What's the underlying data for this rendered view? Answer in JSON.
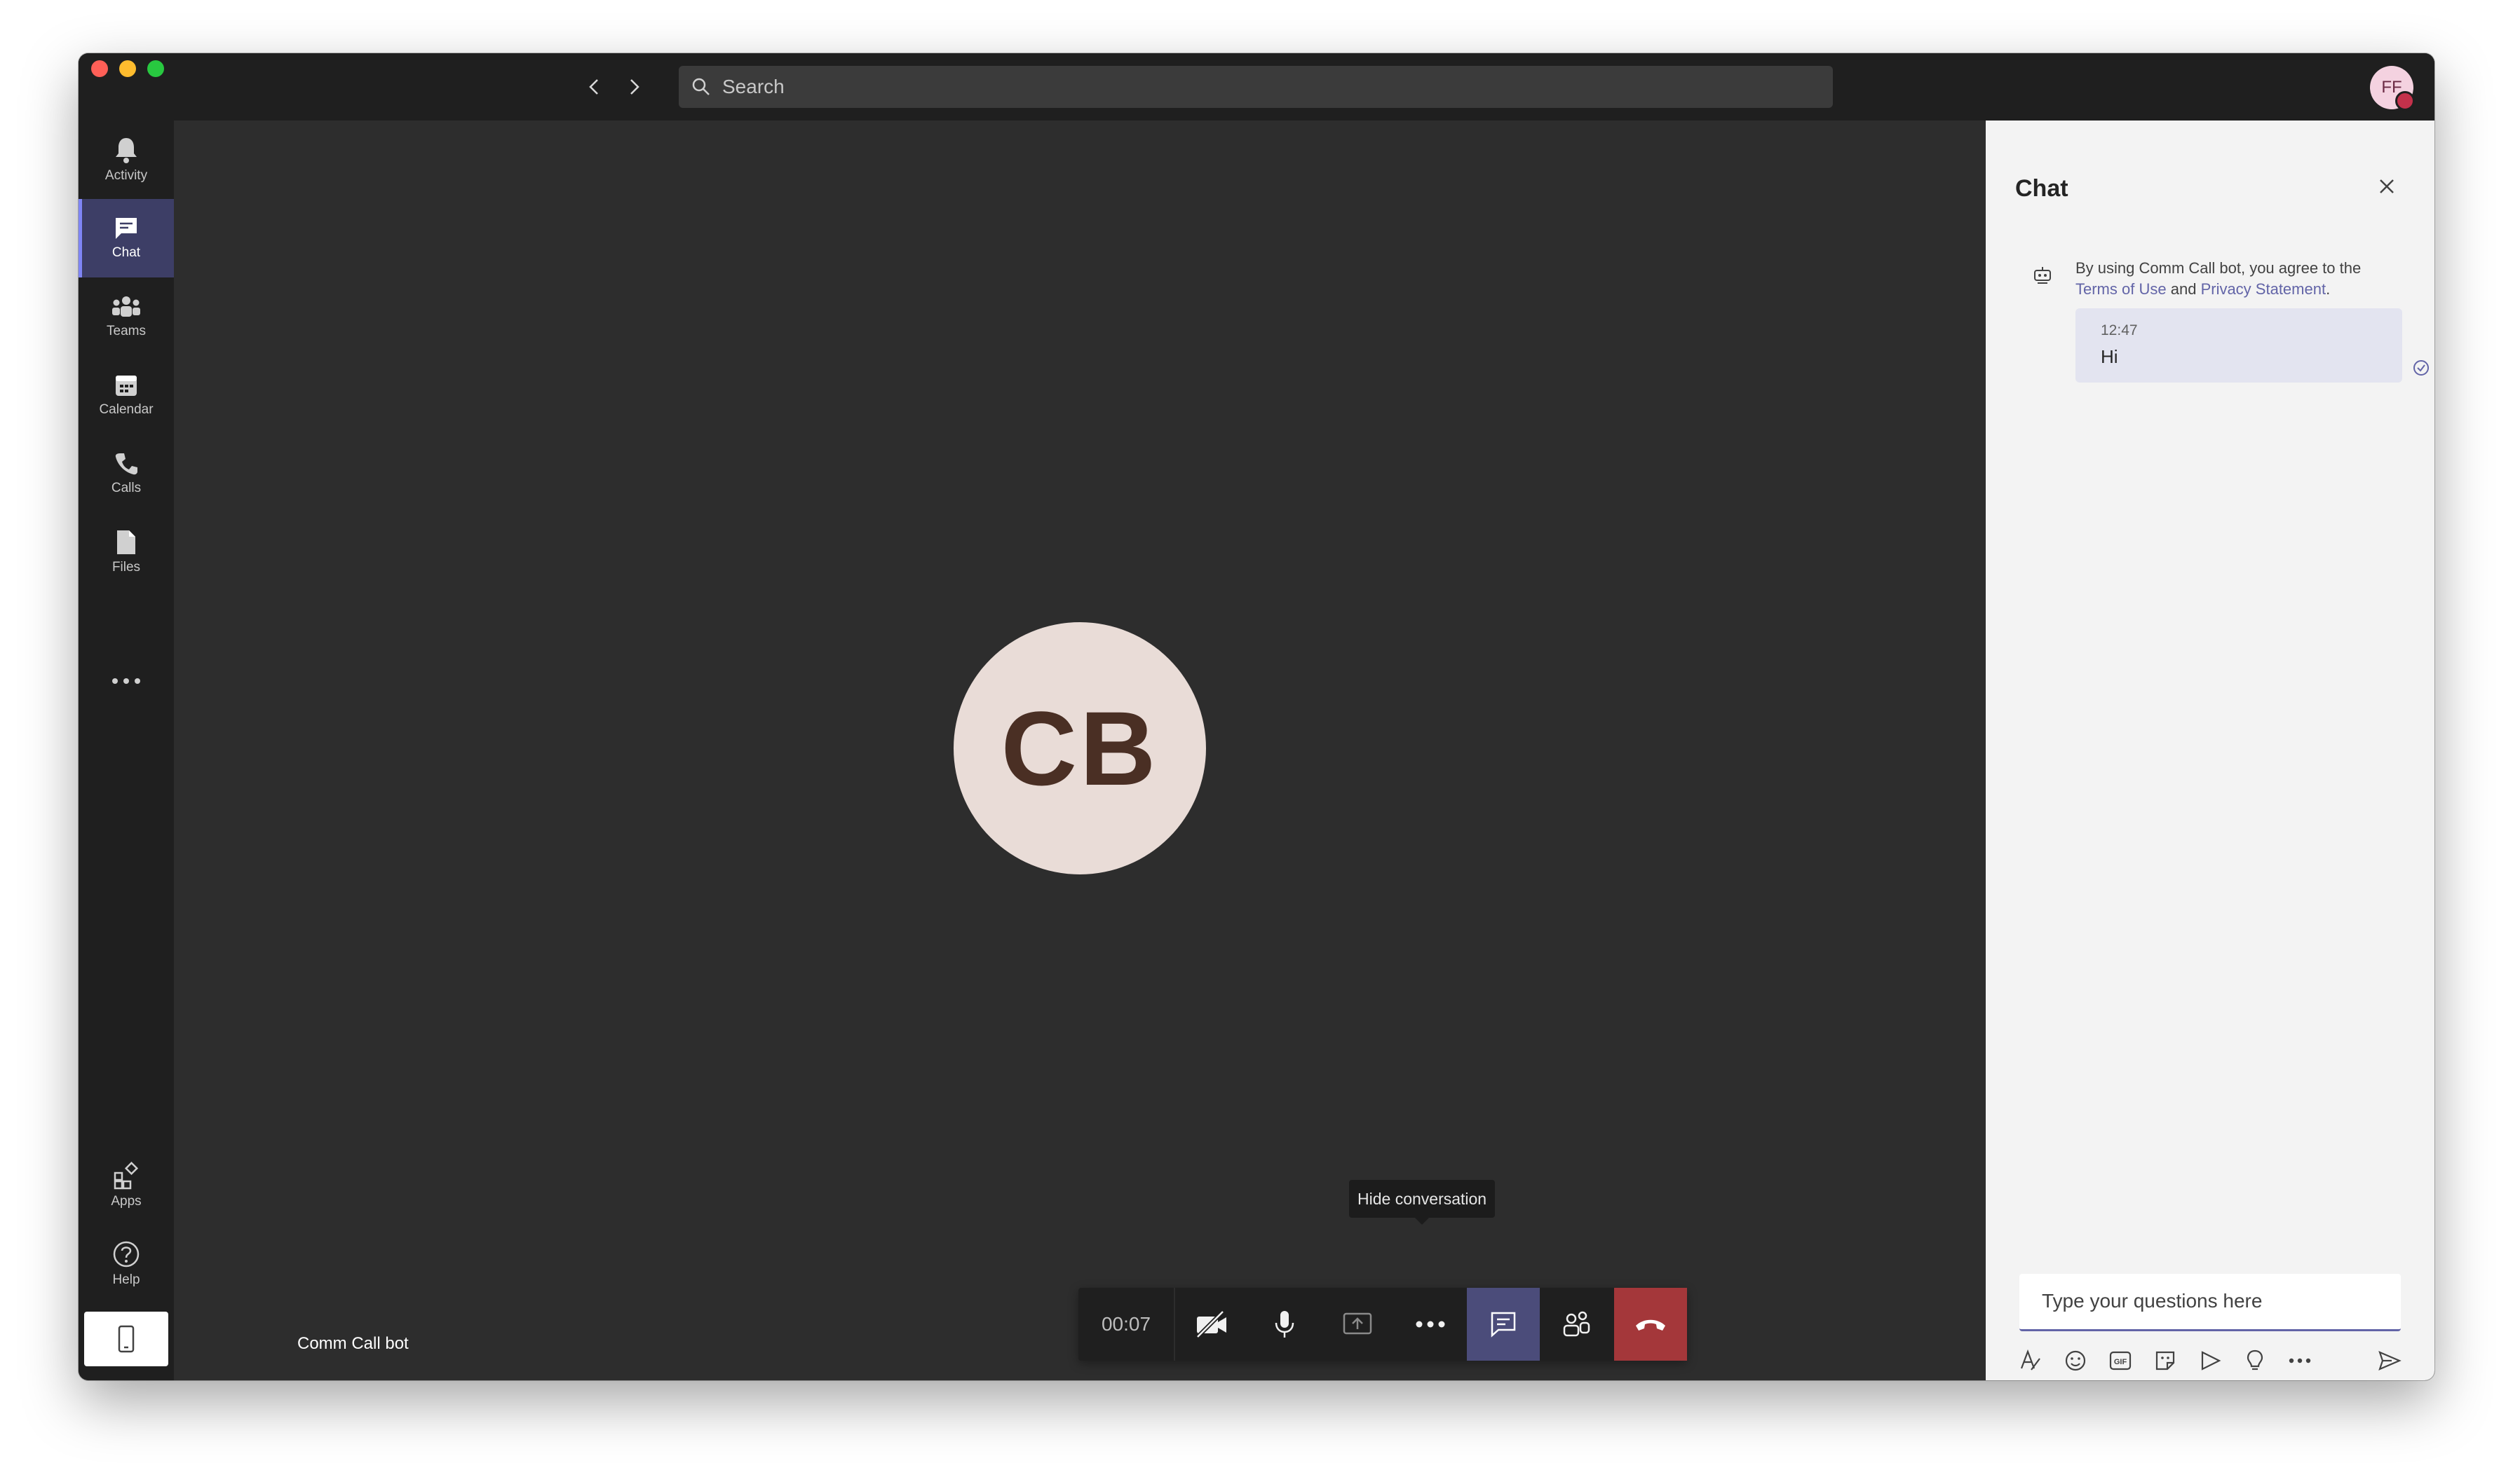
{
  "search": {
    "placeholder": "Search"
  },
  "profile": {
    "initials": "FF"
  },
  "sidebar": {
    "items": [
      {
        "label": "Activity",
        "icon": "bell-icon"
      },
      {
        "label": "Chat",
        "icon": "chat-icon",
        "active": true
      },
      {
        "label": "Teams",
        "icon": "teams-icon"
      },
      {
        "label": "Calendar",
        "icon": "calendar-icon"
      },
      {
        "label": "Calls",
        "icon": "phone-icon"
      },
      {
        "label": "Files",
        "icon": "file-icon"
      }
    ],
    "bottom_items": [
      {
        "label": "Apps",
        "icon": "apps-icon"
      },
      {
        "label": "Help",
        "icon": "help-icon"
      }
    ]
  },
  "call": {
    "avatar_initials": "CB",
    "participant_name": "Comm Call bot",
    "timer": "00:07",
    "tooltip": "Hide conversation"
  },
  "chat": {
    "title": "Chat",
    "notice": {
      "prefix": "By using Comm Call bot, you agree to the",
      "terms_link": "Terms of Use",
      "and": "and",
      "privacy_link": "Privacy Statement",
      "suffix": "."
    },
    "messages": [
      {
        "time": "12:47",
        "text": "Hi"
      }
    ],
    "compose_placeholder": "Type your questions here"
  },
  "colors": {
    "accent": "#6264a7",
    "hangup": "#a4373a",
    "rail_active": "#3d3e66"
  }
}
